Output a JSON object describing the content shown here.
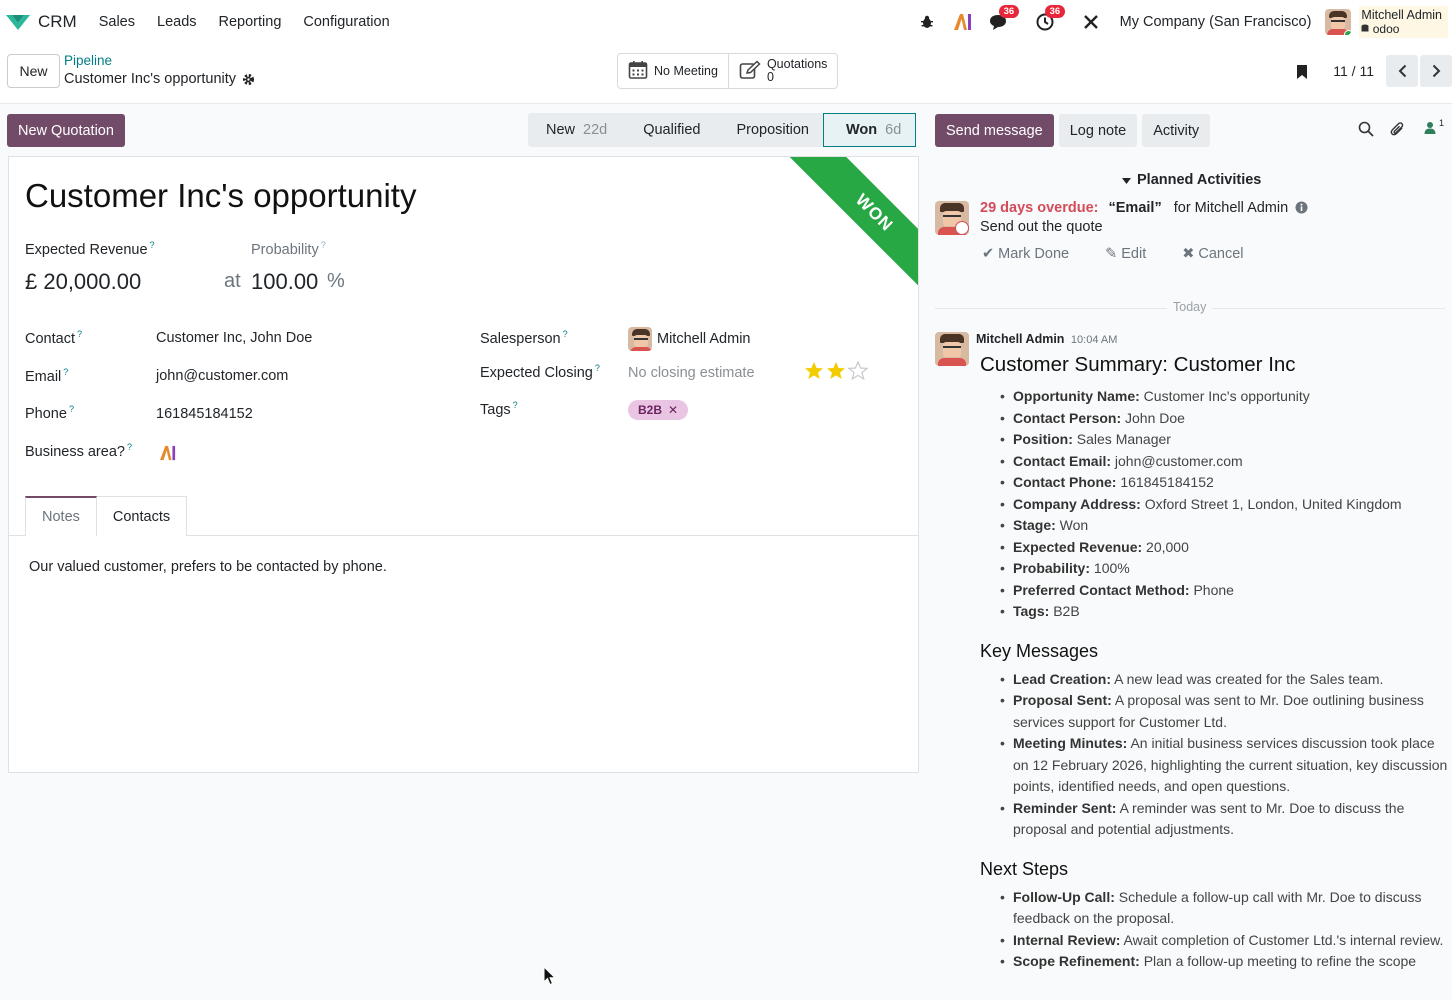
{
  "topnav": {
    "app_name": "CRM",
    "menu": [
      "Sales",
      "Leads",
      "Reporting",
      "Configuration"
    ],
    "messages_badge": "36",
    "activities_badge": "36",
    "company": "My Company (San Francisco)",
    "user_name": "Mitchell Admin",
    "user_db": "odoo"
  },
  "control": {
    "new_label": "New",
    "breadcrumb_parent": "Pipeline",
    "breadcrumb_current": "Customer Inc's opportunity",
    "smart_buttons": [
      {
        "label": "No Meeting",
        "icon": "calendar-icon"
      },
      {
        "label": "Quotations",
        "value": "0",
        "icon": "edit-icon"
      }
    ],
    "pager": "11 / 11"
  },
  "statusbar": {
    "new_quotation": "New Quotation",
    "stages": [
      {
        "name": "New",
        "days": "22d"
      },
      {
        "name": "Qualified",
        "days": ""
      },
      {
        "name": "Proposition",
        "days": ""
      },
      {
        "name": "Won",
        "days": "6d",
        "current": true
      }
    ]
  },
  "form": {
    "ribbon": "WON",
    "title": "Customer Inc's opportunity",
    "expected_revenue_label": "Expected Revenue",
    "expected_revenue": "£ 20,000.00",
    "probability_label": "Probability",
    "probability_at": "at",
    "probability": "100.00",
    "probability_unit": "%",
    "contact_label": "Contact",
    "contact": "Customer Inc, John Doe",
    "email_label": "Email",
    "email": "john@customer.com",
    "phone_label": "Phone",
    "phone": "161845184152",
    "business_area_label": "Business area?",
    "salesperson_label": "Salesperson",
    "salesperson": "Mitchell Admin",
    "expected_closing_label": "Expected Closing",
    "expected_closing_placeholder": "No closing estimate",
    "priority_stars": 2,
    "priority_max": 3,
    "tags_label": "Tags",
    "tags": [
      "B2B"
    ],
    "tabs": [
      "Notes",
      "Contacts"
    ],
    "notes": "Our valued customer, prefers to be contacted by phone."
  },
  "chatter": {
    "send_message": "Send message",
    "log_note": "Log note",
    "activity": "Activity",
    "followers_count": "1",
    "planned_activities": "Planned Activities",
    "activity_item": {
      "overdue": "29 days overdue:",
      "type": "“Email”",
      "for": "for Mitchell Admin",
      "summary": "Send out the quote",
      "mark_done": "Mark Done",
      "edit": "Edit",
      "cancel": "Cancel"
    },
    "today_label": "Today",
    "message": {
      "author": "Mitchell Admin",
      "time": "10:04 AM",
      "heading": "Customer Summary: Customer Inc",
      "summary_items": [
        {
          "k": "Opportunity Name:",
          "v": " Customer Inc's opportunity"
        },
        {
          "k": "Contact Person:",
          "v": " John Doe"
        },
        {
          "k": "Position:",
          "v": " Sales Manager"
        },
        {
          "k": "Contact Email:",
          "v": " john@customer.com"
        },
        {
          "k": "Contact Phone:",
          "v": " 161845184152"
        },
        {
          "k": "Company Address:",
          "v": " Oxford Street 1, London, United Kingdom"
        },
        {
          "k": "Stage:",
          "v": " Won"
        },
        {
          "k": "Expected Revenue:",
          "v": " 20,000"
        },
        {
          "k": "Probability:",
          "v": " 100%"
        },
        {
          "k": "Preferred Contact Method:",
          "v": " Phone"
        },
        {
          "k": "Tags:",
          "v": " B2B"
        }
      ],
      "key_messages_heading": "Key Messages",
      "key_messages": [
        {
          "k": "Lead Creation:",
          "v": " A new lead was created for the Sales team."
        },
        {
          "k": "Proposal Sent:",
          "v": " A proposal was sent to Mr. Doe outlining business services support for Customer Ltd."
        },
        {
          "k": "Meeting Minutes:",
          "v": " An initial business services discussion took place on 12 February 2026, highlighting the current situation, key discussion points, identified needs, and open questions."
        },
        {
          "k": "Reminder Sent:",
          "v": " A reminder was sent to Mr. Doe to discuss the proposal and potential adjustments."
        }
      ],
      "next_steps_heading": "Next Steps",
      "next_steps": [
        {
          "k": "Follow-Up Call:",
          "v": " Schedule a follow-up call with Mr. Doe to discuss feedback on the proposal."
        },
        {
          "k": "Internal Review:",
          "v": " Await completion of Customer Ltd.'s internal review."
        },
        {
          "k": "Scope Refinement:",
          "v": " Plan a follow-up meeting to refine the scope"
        }
      ]
    }
  },
  "colors": {
    "brand": "#714b67",
    "link": "#017e84",
    "won_ribbon": "#28a745",
    "overdue": "#d44c59"
  }
}
